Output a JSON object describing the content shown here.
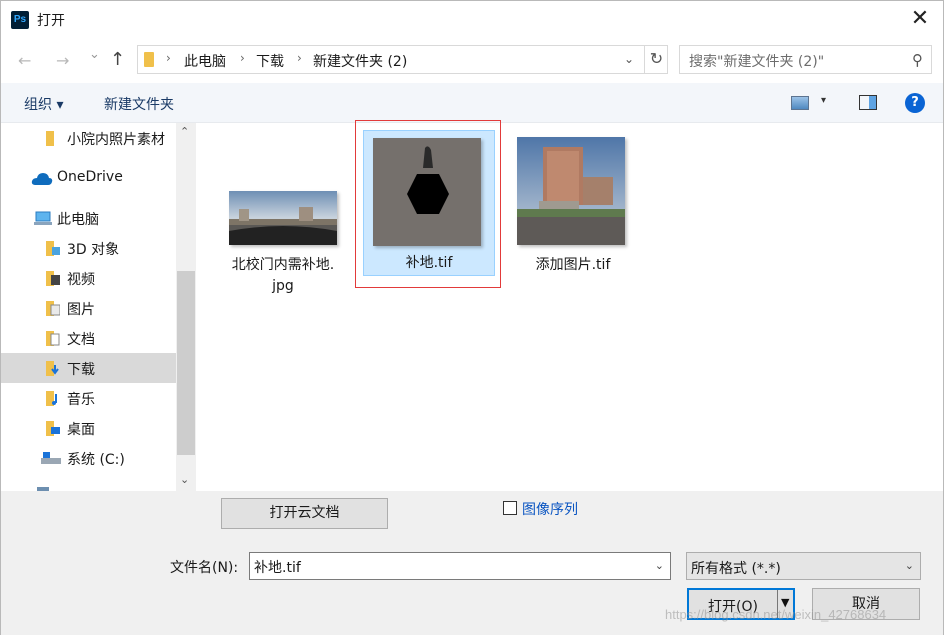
{
  "window": {
    "app_icon": "Ps",
    "title": "打开",
    "close_glyph": "✕"
  },
  "nav": {
    "back_glyph": "←",
    "forward_glyph": "→",
    "recent_glyph": "⌄",
    "up_glyph": "↑",
    "breadcrumb": [
      "此电脑",
      "下载",
      "新建文件夹 (2)"
    ],
    "separator": "›",
    "dropdown_glyph": "⌄",
    "refresh_glyph": "↻",
    "search_placeholder": "搜索\"新建文件夹 (2)\"",
    "search_glyph": "⚲"
  },
  "toolbar": {
    "organize_label": "组织 ▾",
    "new_folder_label": "新建文件夹",
    "view_dropdown_glyph": "▾",
    "help_glyph": "?"
  },
  "sidebar": {
    "items": [
      {
        "label": "小院内照片素材",
        "icon": "folder-icon"
      },
      {
        "label": "OneDrive",
        "icon": "cloud-icon"
      },
      {
        "label": "此电脑",
        "icon": "computer-icon"
      },
      {
        "label": "3D 对象",
        "icon": "3d-objects-icon"
      },
      {
        "label": "视频",
        "icon": "video-icon"
      },
      {
        "label": "图片",
        "icon": "pictures-icon"
      },
      {
        "label": "文档",
        "icon": "documents-icon"
      },
      {
        "label": "下载",
        "icon": "download-icon",
        "selected": true
      },
      {
        "label": "音乐",
        "icon": "music-icon"
      },
      {
        "label": "桌面",
        "icon": "desktop-icon"
      },
      {
        "label": "系统 (C:)",
        "icon": "drive-icon"
      }
    ],
    "scroll_up_glyph": "⌃",
    "scroll_down_glyph": "⌄"
  },
  "files": [
    {
      "name": "北校门内需补地.jpg",
      "line1": "北校门内需补地.",
      "line2": "jpg"
    },
    {
      "name": "补地.tif",
      "line1": "补地.tif",
      "selected": true
    },
    {
      "name": "添加图片.tif",
      "line1": "添加图片.tif"
    }
  ],
  "bottom": {
    "cloud_button": "打开云文档",
    "image_sequence_label": "图像序列",
    "image_sequence_checked": false,
    "filename_label": "文件名(N):",
    "filename_value": "补地.tif",
    "filetype_value": "所有格式 (*.*)",
    "open_button": "打开(O)",
    "cancel_button": "取消",
    "dropdown_glyph": "⌄",
    "split_dropdown_glyph": "▼",
    "watermark": "https://blog.csdn.net/weixin_42768634"
  },
  "colors": {
    "accent": "#0078d7",
    "selection": "#cce8ff",
    "highlight_box": "#e23a3a",
    "link": "#0a55c2"
  }
}
